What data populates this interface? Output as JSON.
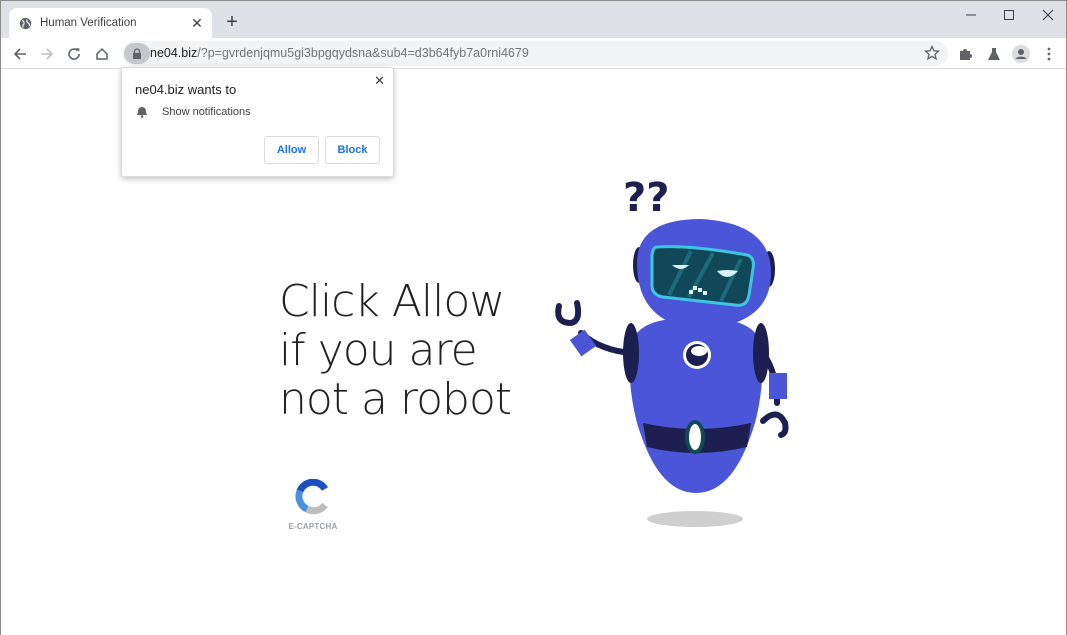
{
  "browser": {
    "tab": {
      "title": "Human Verification",
      "icon": "globe-icon"
    },
    "new_tab_label": "+",
    "url": {
      "host": "ne04.biz",
      "path": "/?p=gvrdenjqmu5gi3bpgqydsna&sub4=d3b64fyb7a0rni4679"
    },
    "toolbar_icons": [
      "back-icon",
      "forward-icon",
      "reload-icon",
      "home-icon",
      "lock-icon",
      "star-icon",
      "extensions-icon",
      "labs-icon",
      "profile-icon",
      "menu-icon"
    ],
    "window_controls": [
      "minimize",
      "maximize",
      "close"
    ]
  },
  "permission_popup": {
    "title": "ne04.biz wants to",
    "permission": "Show notifications",
    "allow_label": "Allow",
    "block_label": "Block",
    "close_label": "✕"
  },
  "page": {
    "headline": "Click Allow if you are not a robot",
    "captcha_label": "E-CAPTCHA",
    "robot_marks": "??"
  },
  "colors": {
    "robot_body": "#4a55d8",
    "robot_dark": "#1c1f4f",
    "visor": "#10485a",
    "visor_rim": "#3ec6e0",
    "link_blue": "#1a73e8"
  }
}
